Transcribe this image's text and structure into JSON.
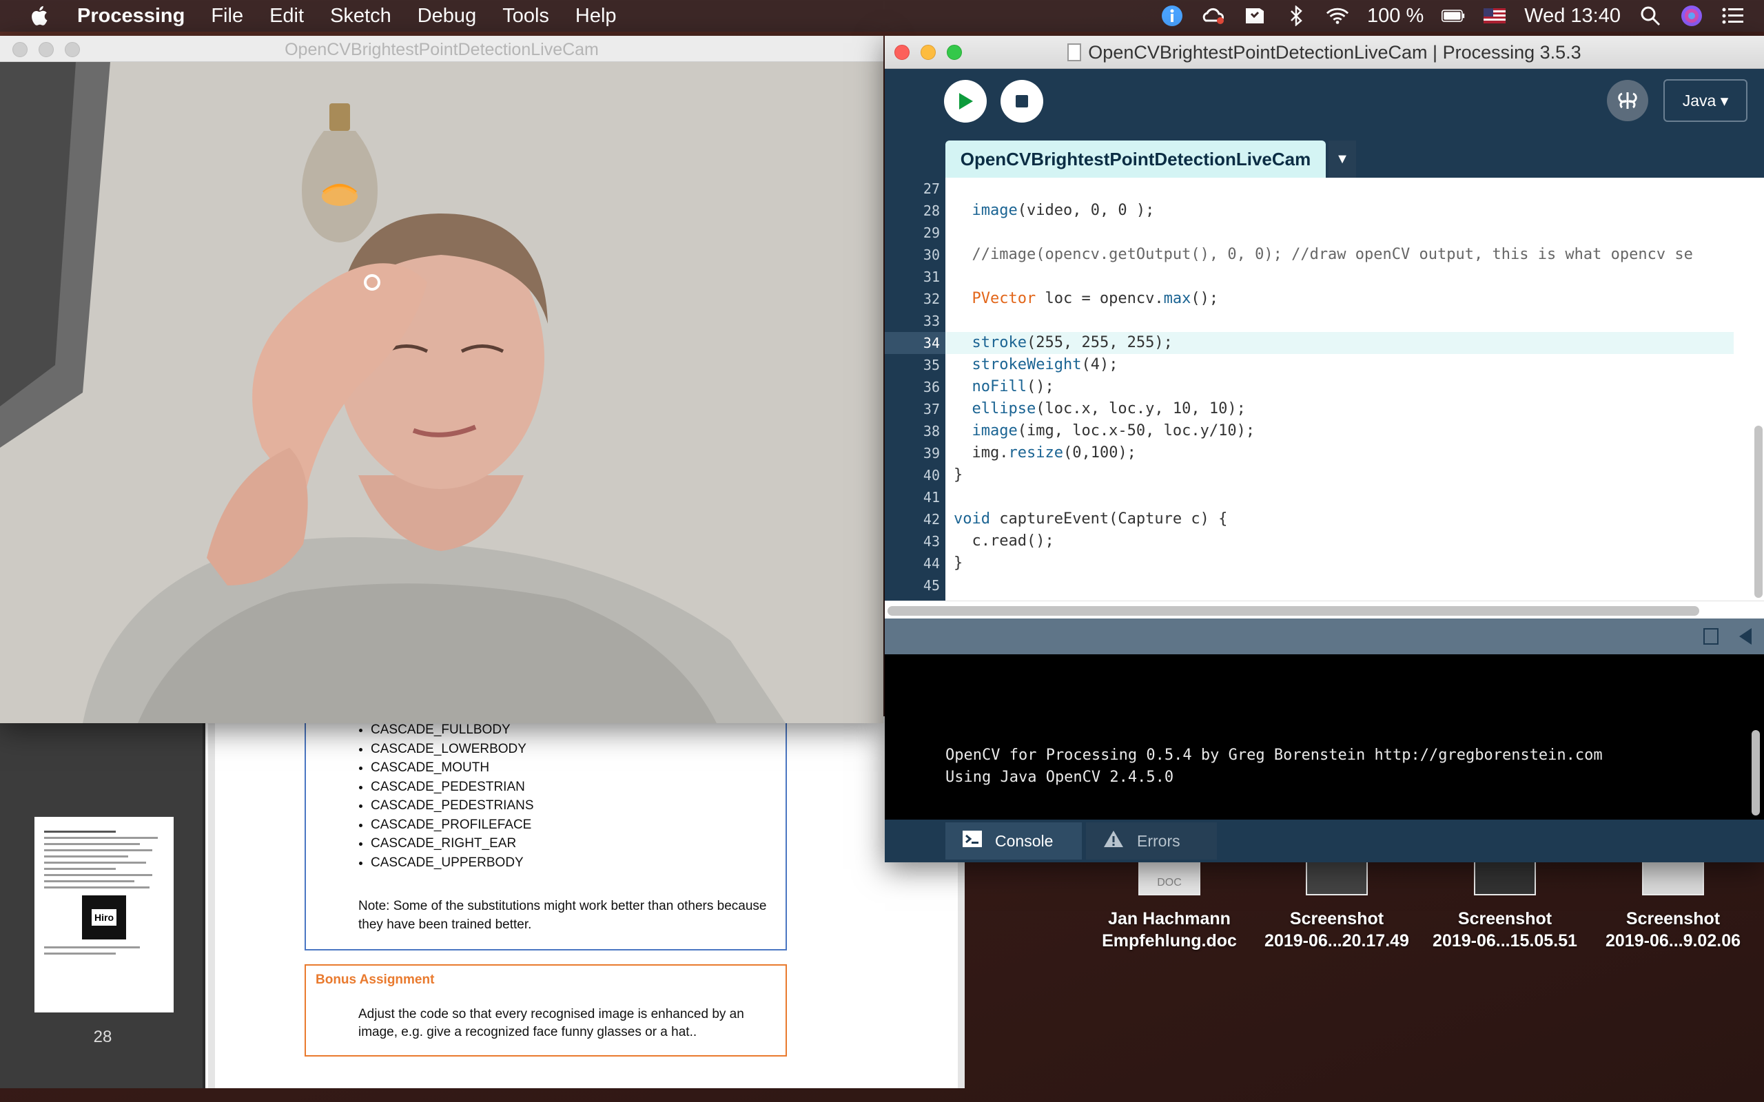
{
  "menubar": {
    "app_name": "Processing",
    "menus": [
      "File",
      "Edit",
      "Sketch",
      "Debug",
      "Tools",
      "Help"
    ],
    "battery": "100 %",
    "clock": "Wed 13:40"
  },
  "cam_window": {
    "title": "OpenCVBrightestPointDetectionLiveCam"
  },
  "ide": {
    "title": "OpenCVBrightestPointDetectionLiveCam | Processing 3.5.3",
    "mode": "Java",
    "tab_label": "OpenCVBrightestPointDetectionLiveCam",
    "tab_menu": "▼",
    "code": {
      "l27": "",
      "l28_fn": "image",
      "l28_rest": "(video, 0, 0 );",
      "l29": "",
      "l30": "//image(opencv.getOutput(), 0, 0); //draw openCV output, this is what opencv se",
      "l31": "",
      "l32_type": "PVector",
      "l32_mid": " loc = opencv.",
      "l32_fn": "max",
      "l32_rest": "();",
      "l33": "",
      "l34_fn": "stroke",
      "l34_rest": "(255, 255, 255);",
      "l35_fn": "strokeWeight",
      "l35_rest": "(4);",
      "l36_fn": "noFill",
      "l36_rest": "();",
      "l37_fn": "ellipse",
      "l37_rest": "(loc.x, loc.y, 10, 10);",
      "l38_fn": "image",
      "l38_rest": "(img, loc.x-50, loc.y/10);",
      "l39_pre": "img.",
      "l39_fn": "resize",
      "l39_rest": "(0,100);",
      "l40": "}",
      "l41": "",
      "l42_kw": "void",
      "l42_rest": " captureEvent(Capture c) {",
      "l43": "c.read();",
      "l44": "}",
      "l45": ""
    },
    "line_numbers": [
      "27",
      "28",
      "29",
      "30",
      "31",
      "32",
      "33",
      "34",
      "35",
      "36",
      "37",
      "38",
      "39",
      "40",
      "41",
      "42",
      "43",
      "44",
      "45"
    ],
    "console_lines": [
      "OpenCV for Processing 0.5.4 by Greg Borenstein http://gregborenstein.com",
      "Using Java OpenCV 2.4.5.0"
    ],
    "console_tab": "Console",
    "errors_tab": "Errors"
  },
  "pdf": {
    "page_number": "28",
    "thumb_marker": "Hiro",
    "list_items": [
      "CASCADE_FULLBODY",
      "CASCADE_LOWERBODY",
      "CASCADE_MOUTH",
      "CASCADE_PEDESTRIAN",
      "CASCADE_PEDESTRIANS",
      "CASCADE_PROFILEFACE",
      "CASCADE_RIGHT_EAR",
      "CASCADE_UPPERBODY"
    ],
    "note": "Note: Some of the substitutions might work better than others because they have been trained better.",
    "bonus_title": "Bonus Assignment",
    "bonus_text": "Adjust the code so that every recognised image is enhanced by an image, e.g. give a recognized face funny glasses or a hat.."
  },
  "desktop_icons": [
    {
      "line1": "Jan Hachmann",
      "line2": "Empfehlung.doc",
      "thumb_label": "DOC"
    },
    {
      "line1": "Screenshot",
      "line2": "2019-06...20.17.49"
    },
    {
      "line1": "Screenshot",
      "line2": "2019-06...15.05.51"
    },
    {
      "line1": "Screenshot",
      "line2": "2019-06...9.02.06"
    }
  ],
  "colors": {
    "ide_bg": "#1e3a52",
    "tab_active": "#d4f4f4",
    "keyword_blue": "#1b6493",
    "type_orange": "#e2661a"
  }
}
